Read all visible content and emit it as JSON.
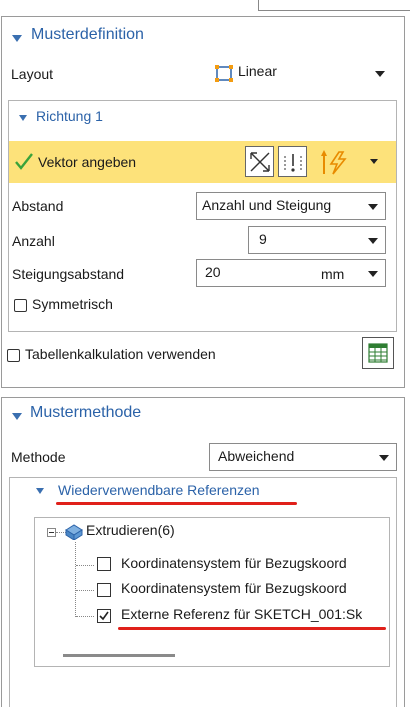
{
  "muster_definition": {
    "title": "Musterdefinition",
    "layout_label": "Layout",
    "layout_value": "Linear"
  },
  "richtung1": {
    "title": "Richtung 1",
    "vektor_label": "Vektor angeben",
    "abstand_label": "Abstand",
    "abstand_value": "Anzahl und Steigung",
    "anzahl_label": "Anzahl",
    "anzahl_value": "9",
    "steigung_label": "Steigungsabstand",
    "steigung_value": "20",
    "steigung_unit": "mm",
    "symmetrisch_label": "Symmetrisch"
  },
  "tabellen": {
    "label": "Tabellenkalkulation verwenden"
  },
  "muster_methode": {
    "title": "Mustermethode",
    "methode_label": "Methode",
    "methode_value": "Abweichend"
  },
  "referenzen": {
    "title": "Wiederverwendbare Referenzen",
    "root_label": "Extrudieren(6)",
    "items": [
      {
        "label": "Koordinatensystem für Bezugskoord",
        "checked": false
      },
      {
        "label": "Koordinatensystem für Bezugskoord",
        "checked": false
      },
      {
        "label": "Externe Referenz für SKETCH_001:Sk",
        "checked": true
      }
    ]
  },
  "colors": {
    "accent": "#2b62a8",
    "highlight": "#fde27a",
    "check_green": "#3aa33a",
    "annotation_red": "#e0201a"
  }
}
